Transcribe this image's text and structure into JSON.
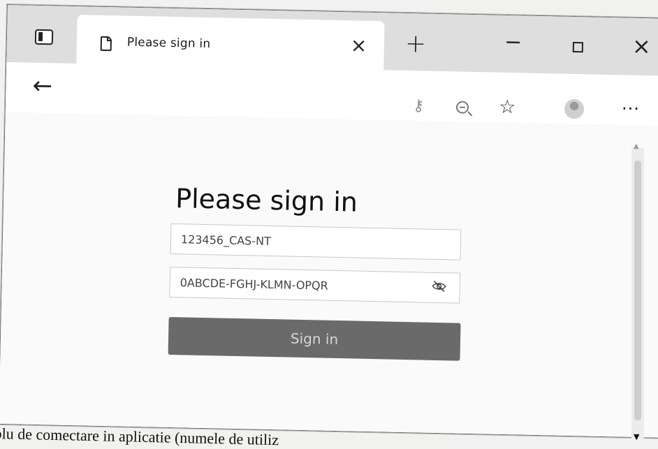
{
  "browser": {
    "tab_title": "Please sign in",
    "tab_close_glyph": "×",
    "new_tab_glyph": "+",
    "minimize_glyph": "−",
    "close_glyph": "×",
    "back_glyph": "←",
    "more_glyph": "···"
  },
  "icons": {
    "sidebar": "sidebar-icon",
    "page": "page-icon",
    "key": "key-icon",
    "zoom_out": "zoom-out-icon",
    "favorites": "favorites-icon",
    "profile": "avatar",
    "eye_off": "eye-off-icon"
  },
  "login": {
    "heading": "Please sign in",
    "username_value": "123456_CAS-NT",
    "password_value": "0ABCDE-FGHJ-KLMN-OPQR",
    "submit_label": "Sign in"
  },
  "caption": "plu de comectare in aplicatie (numele de utiliz",
  "colors": {
    "button_bg": "#6a6a6a",
    "tab_bar": "#dedede",
    "page_bg": "#fafafa"
  }
}
